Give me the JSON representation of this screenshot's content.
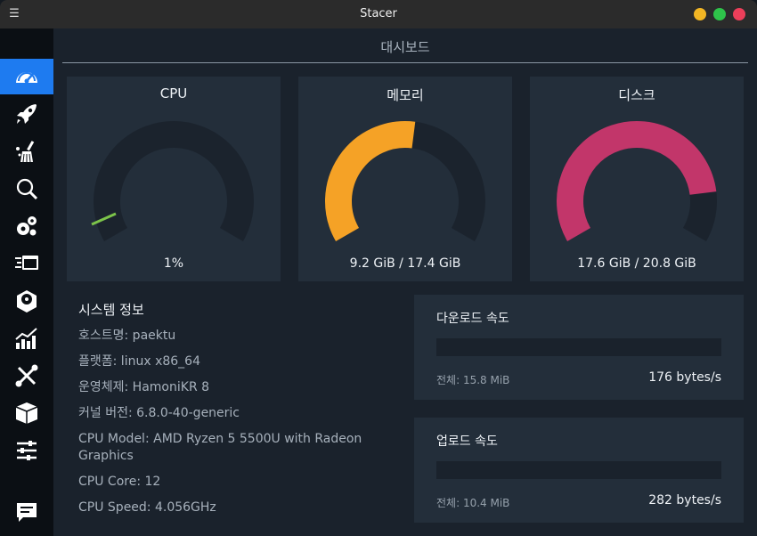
{
  "window": {
    "title": "Stacer",
    "menu_icon": "hamburger-icon"
  },
  "colors": {
    "accent": "#1e7bf0",
    "cpu_arc": "#7cc44a",
    "memory_arc": "#f5a226",
    "disk_arc": "#c2366a",
    "track": "#1b232d"
  },
  "sidebar": {
    "items": [
      {
        "name": "dashboard",
        "icon": "speedometer-icon",
        "active": true
      },
      {
        "name": "startup-apps",
        "icon": "rocket-icon"
      },
      {
        "name": "system-cleaner",
        "icon": "broom-icon"
      },
      {
        "name": "search",
        "icon": "magnifier-icon"
      },
      {
        "name": "services",
        "icon": "gears-icon"
      },
      {
        "name": "processes",
        "icon": "processes-icon"
      },
      {
        "name": "uninstaller",
        "icon": "disk-icon"
      },
      {
        "name": "resources",
        "icon": "chart-icon"
      },
      {
        "name": "helpers",
        "icon": "tools-icon"
      },
      {
        "name": "apt-repository",
        "icon": "package-icon"
      },
      {
        "name": "settings",
        "icon": "sliders-icon"
      },
      {
        "name": "feedback",
        "icon": "chat-icon"
      }
    ]
  },
  "dashboard": {
    "title": "대시보드",
    "gauges": [
      {
        "label": "CPU",
        "value": "1%",
        "fraction": 0.01
      },
      {
        "label": "메모리",
        "value": "9.2 GiB / 17.4 GiB",
        "fraction": 0.53
      },
      {
        "label": "디스크",
        "value": "17.6 GiB / 20.8 GiB",
        "fraction": 0.846
      }
    ],
    "system_info": {
      "title": "시스템 정보",
      "rows": [
        "호스트명: paektu",
        "플랫폼: linux x86_64",
        "운영체제: HamoniKR 8",
        "커널 버전: 6.8.0-40-generic",
        "CPU Model: AMD Ryzen 5 5500U with Radeon Graphics",
        "CPU Core: 12",
        "CPU Speed: 4.056GHz"
      ]
    },
    "download": {
      "title": "다운로드 속도",
      "total": "전체: 15.8 MiB",
      "speed": "176 bytes/s"
    },
    "upload": {
      "title": "업로드 속도",
      "total": "전체: 10.4 MiB",
      "speed": "282 bytes/s"
    }
  }
}
